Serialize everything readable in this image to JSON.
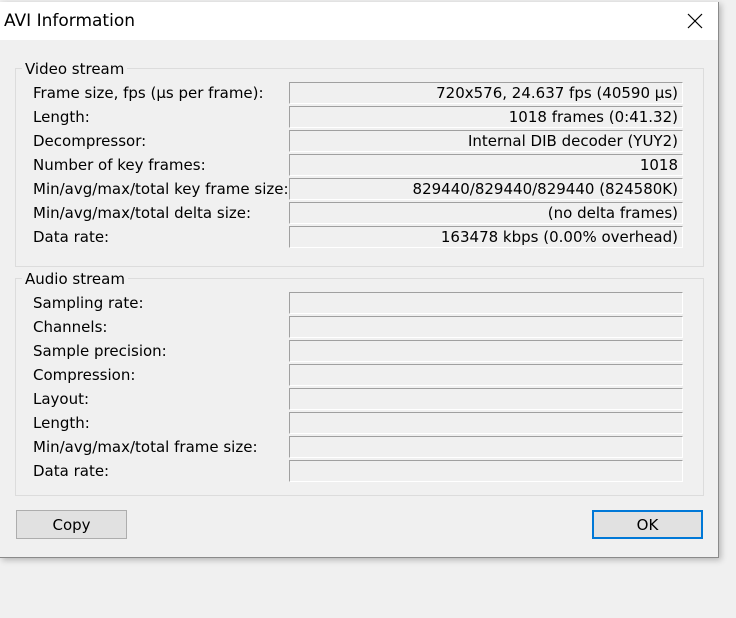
{
  "window": {
    "title": "AVI Information"
  },
  "video": {
    "title": "Video stream",
    "rows": [
      {
        "label": "Frame size, fps (µs per frame):",
        "value": "720x576, 24.637 fps (40590 µs)"
      },
      {
        "label": "Length:",
        "value": "1018 frames (0:41.32)"
      },
      {
        "label": "Decompressor:",
        "value": "Internal DIB decoder (YUY2)"
      },
      {
        "label": "Number of key frames:",
        "value": "1018"
      },
      {
        "label": "Min/avg/max/total key frame size:",
        "value": "829440/829440/829440 (824580K)"
      },
      {
        "label": "Min/avg/max/total delta size:",
        "value": "(no delta frames)"
      },
      {
        "label": "Data rate:",
        "value": "163478 kbps (0.00% overhead)"
      }
    ]
  },
  "audio": {
    "title": "Audio stream",
    "rows": [
      {
        "label": "Sampling rate:",
        "value": ""
      },
      {
        "label": "Channels:",
        "value": ""
      },
      {
        "label": "Sample precision:",
        "value": ""
      },
      {
        "label": "Compression:",
        "value": ""
      },
      {
        "label": "Layout:",
        "value": ""
      },
      {
        "label": "Length:",
        "value": ""
      },
      {
        "label": "Min/avg/max/total frame size:",
        "value": ""
      },
      {
        "label": "Data rate:",
        "value": ""
      }
    ]
  },
  "buttons": {
    "copy": "Copy",
    "ok": "OK"
  }
}
